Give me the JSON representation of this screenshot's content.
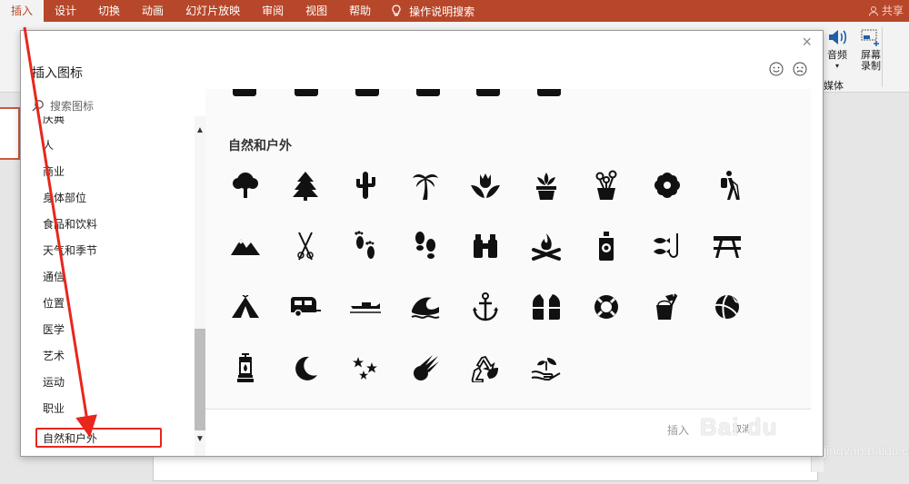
{
  "ribbon": {
    "tabs": [
      "插入",
      "设计",
      "切换",
      "动画",
      "幻灯片放映",
      "审阅",
      "视图",
      "帮助"
    ],
    "active_tab": "插入",
    "tell_me": "操作说明搜索",
    "share": "共享",
    "media": {
      "audio_label": "音频",
      "screen_label_1": "屏幕",
      "screen_label_2": "录制",
      "group_label": "媒体"
    }
  },
  "dialog": {
    "title": "插入图标",
    "search_placeholder": "搜索图标",
    "categories": [
      "庆典",
      "人",
      "商业",
      "身体部位",
      "食品和饮料",
      "天气和季节",
      "通信",
      "位置",
      "医学",
      "艺术",
      "运动",
      "职业",
      "自然和户外"
    ],
    "selected_category": "自然和户外",
    "section_title": "自然和户外",
    "icons": [
      "tree-icon",
      "pine-tree-icon",
      "cactus-icon",
      "palm-tree-icon",
      "tulip-icon",
      "potted-plant-icon",
      "flower-pot-icon",
      "flower-icon",
      "hiker-icon",
      "mountains-icon",
      "ski-poles-icon",
      "footprints-icon",
      "shoe-prints-icon",
      "binoculars-icon",
      "campfire-icon",
      "bug-spray-icon",
      "fishing-icon",
      "picnic-table-icon",
      "tent-icon",
      "camper-trailer-icon",
      "boat-icon",
      "wave-icon",
      "anchor-icon",
      "life-jacket-icon",
      "life-ring-icon",
      "sand-bucket-icon",
      "beach-ball-icon",
      "lantern-icon",
      "crescent-moon-icon",
      "stars-icon",
      "meteor-icon",
      "recycle-icon",
      "plant-hand-icon"
    ],
    "insert_label": "插入",
    "cancel_label": "取消"
  },
  "watermark": {
    "text": "Bai du",
    "sub": "jingyan.baidu.com"
  },
  "colors": {
    "ribbon": "#b7472a",
    "highlight": "#e8261c"
  }
}
